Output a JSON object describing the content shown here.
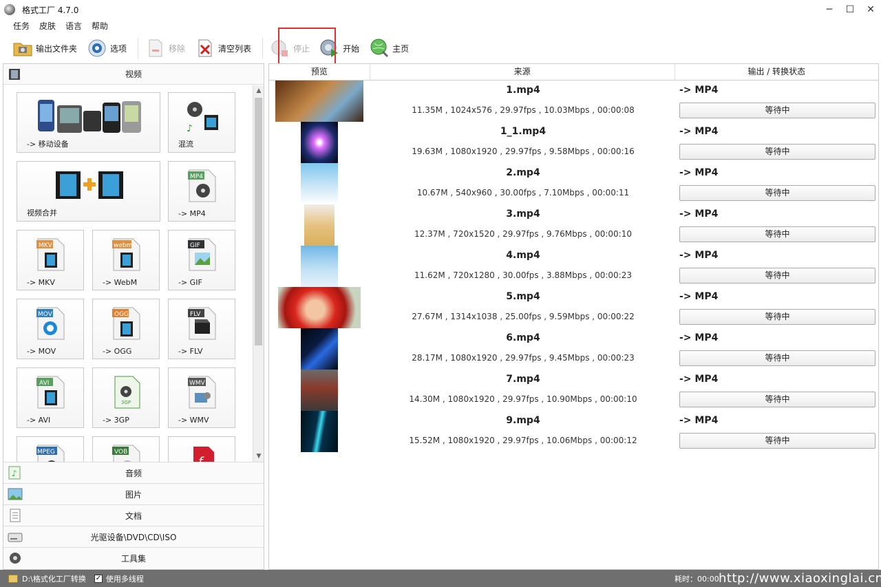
{
  "window": {
    "title": "格式工厂 4.7.0",
    "minimize": "─",
    "maximize": "☐",
    "close": "✕"
  },
  "menu": [
    "任务",
    "皮肤",
    "语言",
    "帮助"
  ],
  "toolbar": {
    "output_folder": "输出文件夹",
    "options": "选项",
    "remove": "移除",
    "clear_list": "清空列表",
    "stop": "停止",
    "start": "开始",
    "home": "主页"
  },
  "left": {
    "video_header": "视频",
    "tiles": [
      {
        "label": "-> 移动设备"
      },
      {
        "label": "混流"
      },
      {
        "label": "视频合并"
      },
      {
        "label": "-> MP4",
        "badge": "MP4"
      },
      {
        "label": "-> MKV",
        "badge": "MKV"
      },
      {
        "label": "-> WebM",
        "badge": "webm"
      },
      {
        "label": "-> GIF",
        "badge": "GIF"
      },
      {
        "label": "-> MOV",
        "badge": "MOV"
      },
      {
        "label": "-> OGG",
        "badge": "OGG"
      },
      {
        "label": "-> FLV",
        "badge": "FLV"
      },
      {
        "label": "-> AVI",
        "badge": "AVI"
      },
      {
        "label": "-> 3GP",
        "badge": "3GP"
      },
      {
        "label": "-> WMV",
        "badge": "WMV"
      },
      {
        "label": "",
        "badge": "MPEG"
      },
      {
        "label": "",
        "badge": "VOB"
      },
      {
        "label": "",
        "badge": ""
      }
    ],
    "categories": [
      "音频",
      "图片",
      "文档",
      "光驱设备\\DVD\\CD\\ISO",
      "工具集"
    ]
  },
  "table": {
    "headers": {
      "preview": "预览",
      "source": "来源",
      "output": "输出 / 转换状态"
    },
    "rows": [
      {
        "name": "1.mp4",
        "info": "11.35M , 1024x576 , 29.97fps , 10.03Mbps , 00:00:08",
        "format": "-> MP4",
        "status": "等待中"
      },
      {
        "name": "1_1.mp4",
        "info": "19.63M , 1080x1920 , 29.97fps , 9.58Mbps , 00:00:16",
        "format": "-> MP4",
        "status": "等待中"
      },
      {
        "name": "2.mp4",
        "info": "10.67M , 540x960 , 30.00fps , 7.10Mbps , 00:00:11",
        "format": "-> MP4",
        "status": "等待中"
      },
      {
        "name": "3.mp4",
        "info": "12.37M , 720x1520 , 29.97fps , 9.76Mbps , 00:00:10",
        "format": "-> MP4",
        "status": "等待中"
      },
      {
        "name": "4.mp4",
        "info": "11.62M , 720x1280 , 30.00fps , 3.88Mbps , 00:00:23",
        "format": "-> MP4",
        "status": "等待中"
      },
      {
        "name": "5.mp4",
        "info": "27.67M , 1314x1038 , 25.00fps , 9.59Mbps , 00:00:22",
        "format": "-> MP4",
        "status": "等待中"
      },
      {
        "name": "6.mp4",
        "info": "28.17M , 1080x1920 , 29.97fps , 9.45Mbps , 00:00:23",
        "format": "-> MP4",
        "status": "等待中"
      },
      {
        "name": "7.mp4",
        "info": "14.30M , 1080x1920 , 29.97fps , 10.90Mbps , 00:00:10",
        "format": "-> MP4",
        "status": "等待中"
      },
      {
        "name": "9.mp4",
        "info": "15.52M , 1080x1920 , 29.97fps , 10.06Mbps , 00:00:12",
        "format": "-> MP4",
        "status": "等待中"
      }
    ]
  },
  "statusbar": {
    "path": "D:\\格式化工厂转换",
    "multithread": "使用多线程",
    "elapsed": "耗时：00:00",
    "watermark": "http://www.xiaoxinglai.cn"
  }
}
